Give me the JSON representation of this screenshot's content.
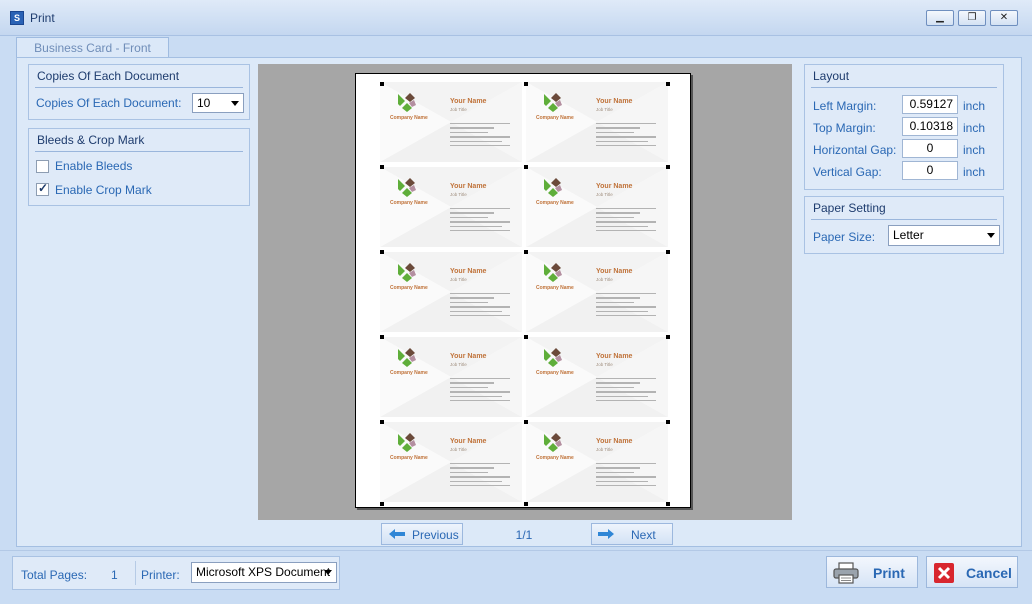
{
  "window": {
    "title": "Print",
    "icon": "app-icon",
    "minimize_label": "▁",
    "restore_label": "❐",
    "close_label": "✕"
  },
  "tab": {
    "label": "Business Card - Front"
  },
  "copies": {
    "title": "Copies Of Each Document",
    "label": "Copies Of Each Document:",
    "value": "10"
  },
  "bleeds": {
    "title": "Bleeds & Crop Mark",
    "enable_bleeds": "Enable Bleeds",
    "enable_bleeds_checked": false,
    "enable_crop": "Enable Crop Mark",
    "enable_crop_checked": true
  },
  "layout": {
    "title": "Layout",
    "left_margin_label": "Left Margin:",
    "left_margin": "0.59127",
    "top_margin_label": "Top Margin:",
    "top_margin": "0.10318",
    "h_gap_label": "Horizontal Gap:",
    "h_gap": "0",
    "v_gap_label": "Vertical Gap:",
    "v_gap": "0",
    "unit": "inch"
  },
  "paper": {
    "title": "Paper Setting",
    "label": "Paper Size:",
    "value": "Letter"
  },
  "card": {
    "name": "Your Name",
    "job": "Job Title",
    "company": "Company Name",
    "colors": {
      "accent": "#c0733a",
      "logo_green": "#5fae3a",
      "logo_brown": "#6b4a3a",
      "logo_mauve": "#b48fa0"
    }
  },
  "pager": {
    "previous": "Previous",
    "next": "Next",
    "indicator": "1/1"
  },
  "footer": {
    "total_pages_label": "Total Pages:",
    "total_pages": "1",
    "printer_label": "Printer:",
    "printer": "Microsoft XPS Document"
  },
  "actions": {
    "print": "Print",
    "cancel": "Cancel"
  }
}
